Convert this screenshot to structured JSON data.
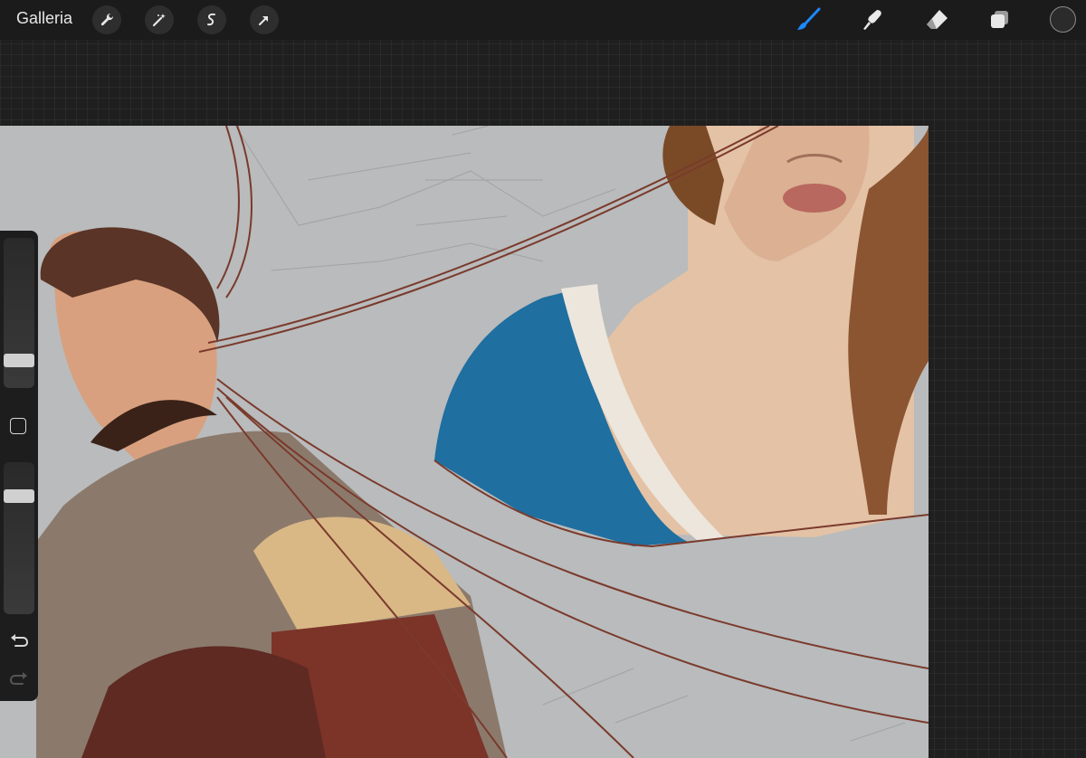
{
  "topbar": {
    "gallery_label": "Galleria",
    "left_tools": [
      "wrench-icon",
      "magic-wand-icon",
      "selection-icon",
      "transform-arrow-icon"
    ],
    "right_tools": [
      "brush-icon",
      "smudge-icon",
      "eraser-icon",
      "layers-icon"
    ],
    "active_tool": "brush",
    "accent_color": "#1e88ff",
    "current_color": "#2b2b2b"
  },
  "sidebar": {
    "brush_size_level": 0.25,
    "opacity_level": 0.8
  }
}
